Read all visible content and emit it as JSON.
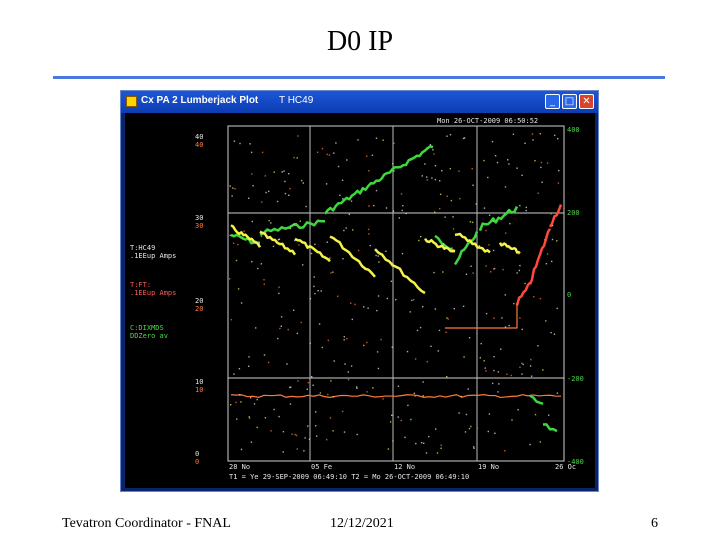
{
  "slide": {
    "title": "D0 IP",
    "footer_left": "Tevatron Coordinator - FNAL",
    "footer_center": "12/12/2021",
    "footer_right": "6"
  },
  "window": {
    "title": "Cx PA 2 Lumberjack Plot",
    "subtitle": "T HC49",
    "buttons": {
      "minimize": "_",
      "maximize": "□",
      "close": "✕"
    }
  },
  "plot": {
    "timestamp": "Mon 26-OCT-2009 06:50:52",
    "left_axis": [
      "40",
      "40",
      "30",
      "30",
      "20",
      "20",
      "10",
      "10",
      "0",
      "0"
    ],
    "right_axis": [
      "400",
      "200",
      "0",
      "-200",
      "-400"
    ],
    "x_ticks": [
      "28 No",
      "05 Fe",
      "12 No",
      "19 No",
      "26 Oc"
    ],
    "time_range": "T1 = Ye 29-SEP-2009 06:49:10     T2 = Mo 26-OCT-2009 06:49:10",
    "legend": [
      {
        "label": "T:HC49",
        "detail": ".1EEup Amps",
        "color": "#e8e8e8"
      },
      {
        "label": "T:FT:",
        "detail": ".1EEup Amps",
        "color": "#ff5a5a"
      },
      {
        "label": "C:DIXMDS",
        "detail": "DDZero  av",
        "color": "#4ad84a"
      }
    ],
    "colors": {
      "green": "#3ed83e",
      "yellow": "#f2f24a",
      "red": "#ff4a3a",
      "orange": "#ff7a3a",
      "white": "#e6e6e6"
    }
  }
}
